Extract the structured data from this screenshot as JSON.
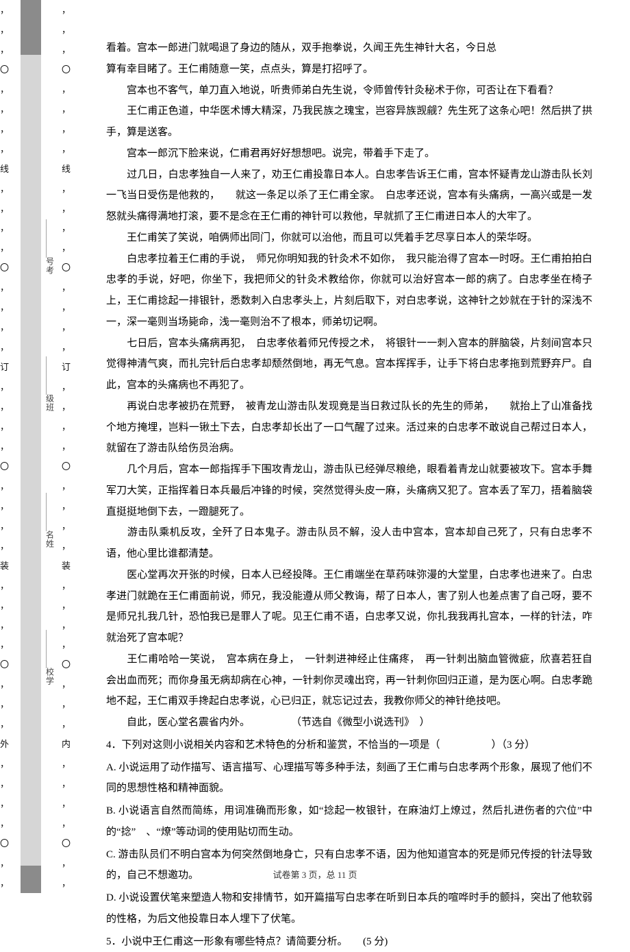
{
  "gutter": {
    "outer_marks": [
      "，",
      "，",
      "，",
      "〇",
      "，",
      "，",
      "，",
      "，",
      "线",
      "，",
      "，",
      "，",
      "，",
      "〇",
      "，",
      "，",
      "，",
      "，",
      "订",
      "，",
      "，",
      "，",
      "，",
      "〇",
      "，",
      "，",
      "，",
      "，",
      "装",
      "，",
      "，",
      "，",
      "，",
      "〇",
      "，",
      "，",
      "，",
      "外",
      "，",
      "，",
      "，",
      "，",
      "〇",
      "，",
      "，"
    ],
    "inner_marks": [
      "，",
      "，",
      "，",
      "〇",
      "，",
      "，",
      "，",
      "，",
      "线",
      "，",
      "，",
      "，",
      "，",
      "〇",
      "，",
      "，",
      "，",
      "，",
      "订",
      "，",
      "，",
      "，",
      "，",
      "〇",
      "，",
      "，",
      "，",
      "，",
      "装",
      "，",
      "，",
      "，",
      "，",
      "〇",
      "，",
      "，",
      "，",
      "内",
      "，",
      "，",
      "，",
      "，",
      "〇",
      "，",
      "，"
    ],
    "mid_kao": "号考",
    "mid_ban": "级班",
    "mid_xing": "名姓",
    "mid_xiao": "校学",
    "dashes": "＿＿＿＿＿＿＿"
  },
  "paras": [
    "看着。宫本一郎进门就喝退了身边的随从，双手抱拳说，久闻王先生神针大名，今日总",
    "算有幸目睹了。王仁甫随意一笑，点点头，算是打招呼了。",
    "　　宫本也不客气，单刀直入地说，听贵师弟白先生说，令师曾传针灸秘术于你，可否让在下看看？",
    "　　王仁甫正色道，中华医术博大精深，乃我民族之瑰宝，岂容异族觊觎？先生死了这条心吧！然后拱了拱手，算是送客。",
    "　　宫本一郎沉下脸来说，仁甫君再好好想想吧。说完，带着手下走了。",
    "　　过几日，白忠孝独自一人来了，劝王仁甫投靠日本人。白忠孝告诉王仁甫，宫本怀疑青龙山游击队长刘一飞当日受伤是他救的，　　就这一条足以杀了王仁甫全家。　白忠孝还说，宫本有头痛病，一高兴或是一发怒就头痛得满地打滚，要不是念在王仁甫的神针可以救他，早就抓了王仁甫进日本人的大牢了。",
    "　　王仁甫笑了笑说，咱俩师出同门，你就可以治他，而且可以凭着手艺尽享日本人的荣华呀。",
    "　　白忠孝拉着王仁甫的手说，　师兄你明知我的针灸术不如你，　我只能治得了宫本一时呀。王仁甫拍拍白忠孝的手说，好吧，你坐下，我把师父的针灸术教给你，你就可以治好宫本一郎的病了。白忠孝坐在椅子上，王仁甫捻起一排银针，悉数刺入白忠孝头上，片刻后取下，对白忠孝说，这神针之妙就在于针的深浅不一，深一毫则当场毙命，浅一毫则治不了根本，师弟切记啊。",
    "　　七日后，宫本头痛病再犯，　白忠孝依着师兄传授之术，　将银针一一刺入宫本的胖脑袋，片刻间宫本只觉得神清气爽，而扎完针后白忠孝却颓然倒地，再无气息。宫本挥挥手，让手下将白忠孝拖到荒野弃尸。自此，宫本的头痛病也不再犯了。",
    "　　再说白忠孝被扔在荒野，　被青龙山游击队发现竟是当日救过队长的先生的师弟，　　就抬上了山准备找个地方掩埋，岂料一锹土下去，白忠孝却长出了一口气醒了过来。活过来的白忠孝不敢说自己帮过日本人，就留在了游击队给伤员治病。",
    "　　几个月后，宫本一郎指挥手下围攻青龙山，游击队已经弹尽粮绝，眼看着青龙山就要被攻下。宫本手舞军刀大笑，正指挥着日本兵最后冲锋的时候，突然觉得头皮一麻，头痛病又犯了。宫本丢了军刀，捂着脑袋直挺挺地倒下去，一蹬腿死了。",
    "　　游击队乘机反攻，全歼了日本鬼子。游击队员不解，没人击中宫本，宫本却自己死了，只有白忠孝不语，他心里比谁都清楚。",
    "　　医心堂再次开张的时候，日本人已经投降。王仁甫端坐在草药味弥漫的大堂里，白忠孝也进来了。白忠孝进门就跪在王仁甫面前说，师兄，我没能遵从师父教诲，帮了日本人，害了别人也差点害了自己呀，要不是师兄扎我几针，恐怕我已是罪人了呢。见王仁甫不语，白忠孝又说，你扎我我再扎宫本，一样的针法，咋就治死了宫本呢？",
    "　　王仁甫哈哈一笑说，　宫本病在身上，　一针刺进神经止住痛疼，　再一针刺出脑血管微疵，欣喜若狂自会出血而死；而你身虽无病却病在心神，一针刺你灵魂出窍，再一针刺你回归正道，是为医心啊。白忠孝跪地不起，王仁甫双手搀起白忠孝说，心已归正，就忘记过去，我教你师父的神针绝技吧。",
    "　　自此，医心堂名震省内外。　　　　　（节选自《微型小说选刊》　）"
  ],
  "q4": {
    "stem": "4．下列对这则小说相关内容和艺术特色的分析和鉴赏，不恰当的一项是（　　　　　）（3 分）",
    "A": "A.  小说运用了动作描写、语言描写、心理描写等多种手法，刻画了王仁甫与白忠孝两个形象，展现了他们不同的思想性格和精神面貌。",
    "B": "B.  小说语言自然而简练，用词准确而形象，如“捻起一枚银针，在麻油灯上燎过，然后扎进伤者的穴位”中的“捻”　、“燎”等动词的使用贴切而生动。",
    "C": "C.  游击队员们不明白宫本为何突然倒地身亡，只有白忠孝不语，因为他知道宫本的死是师兄传授的针法导致的，自己不想邀功。",
    "D": "D.  小说设置伏笔来塑造人物和安排情节，如开篇描写白忠孝在听到日本兵的喧哗时手的颤抖，突出了他软弱的性格，为后文他投靠日本人埋下了伏笔。"
  },
  "q5": "5．小说中王仁甫这一形象有哪些特点？请简要分析。　　(5 分)",
  "footer": "试卷第 3 页，总 11 页"
}
